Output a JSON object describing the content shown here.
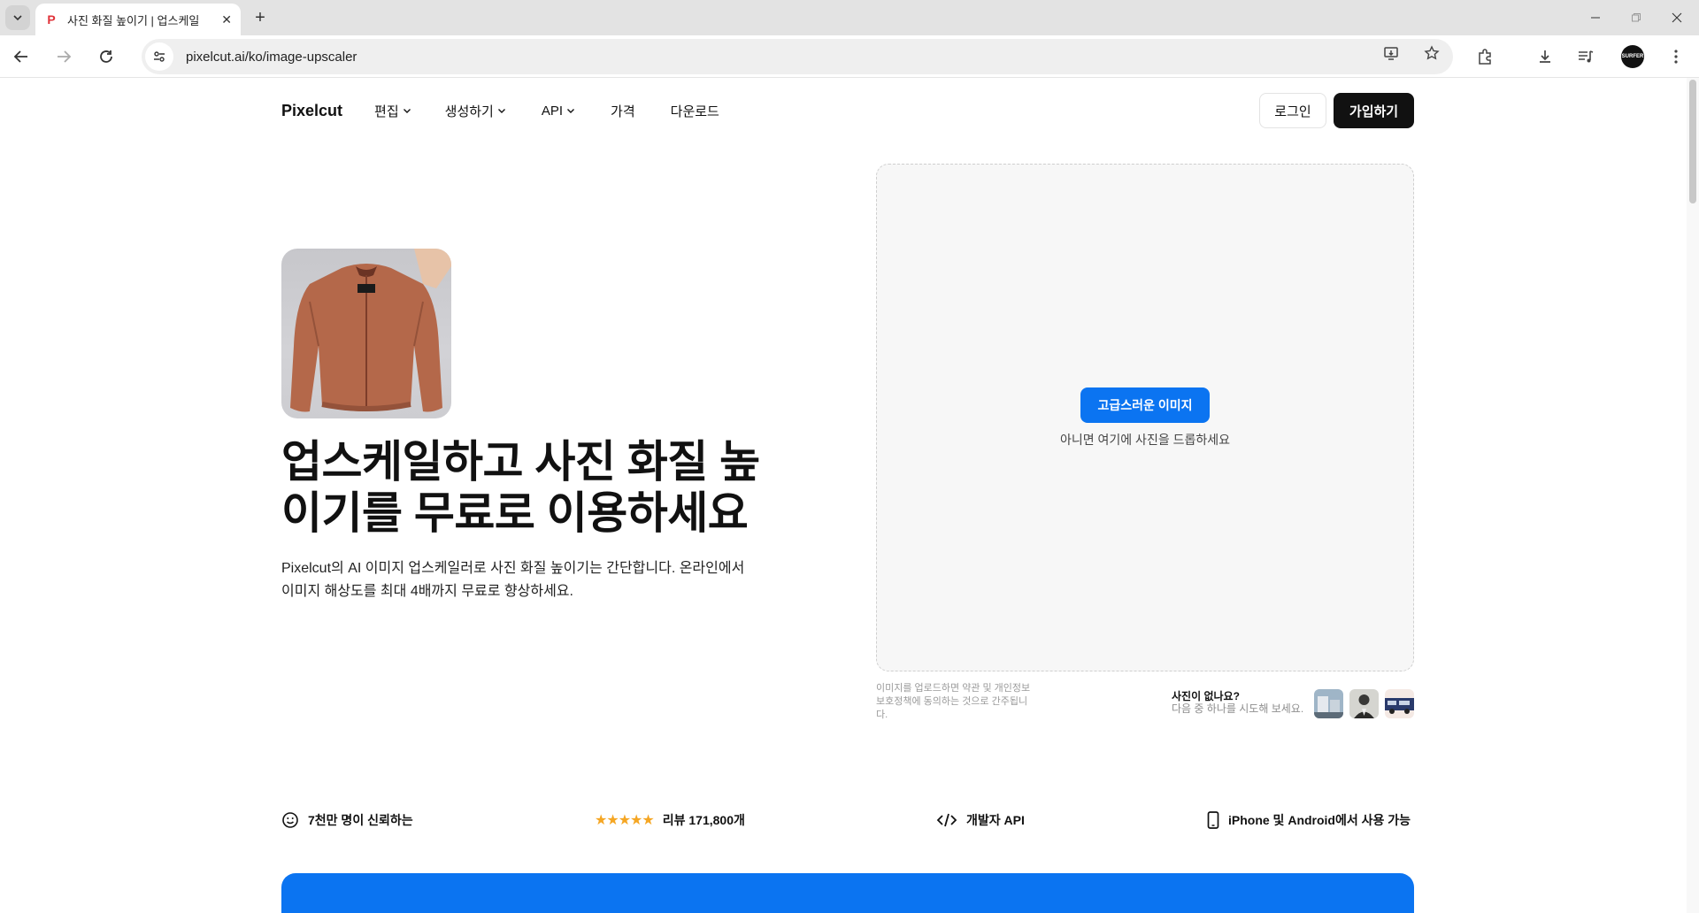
{
  "browser": {
    "tab_title": "사진 화질 높이기 | 업스케일",
    "url": "pixelcut.ai/ko/image-upscaler",
    "avatar_text": "SURFER"
  },
  "nav": {
    "brand": "Pixelcut",
    "items": [
      {
        "label": "편집",
        "dropdown": true
      },
      {
        "label": "생성하기",
        "dropdown": true
      },
      {
        "label": "API",
        "dropdown": true
      },
      {
        "label": "가격",
        "dropdown": false
      },
      {
        "label": "다운로드",
        "dropdown": false
      }
    ],
    "login_label": "로그인",
    "signup_label": "가입하기"
  },
  "hero": {
    "title_line1": "업스케일하고 사진 화질 높",
    "title_line2": "이기를 무료로 이용하세요",
    "desc_line1": "Pixelcut의 AI 이미지 업스케일러로 사진 화질 높이기는 간단합니다. 온라인에서",
    "desc_line2": "이미지 해상도를 최대 4배까지 무료로 향상하세요."
  },
  "upload": {
    "button_label": "고급스러운 이미지",
    "hint": "아니면 여기에 사진을 드롭하세요",
    "terms_line1": "이미지를 업로드하면 약관 및 개인정보",
    "terms_line2": "보호정책에 동의하는 것으로 간주됩니",
    "terms_line3": "다.",
    "no_photo_q": "사진이 없나요?",
    "no_photo_sub": "다음 중 하나를 시도해 보세요."
  },
  "trust": {
    "users": "7천만 명이 신뢰하는",
    "stars": "★★★★★",
    "reviews": "리뷰 171,800개",
    "api": "개발자 API",
    "platforms": "iPhone 및 Android에서 사용 가능"
  },
  "colors": {
    "accent": "#0b74f1",
    "dark": "#111111",
    "star": "#f5a623"
  }
}
